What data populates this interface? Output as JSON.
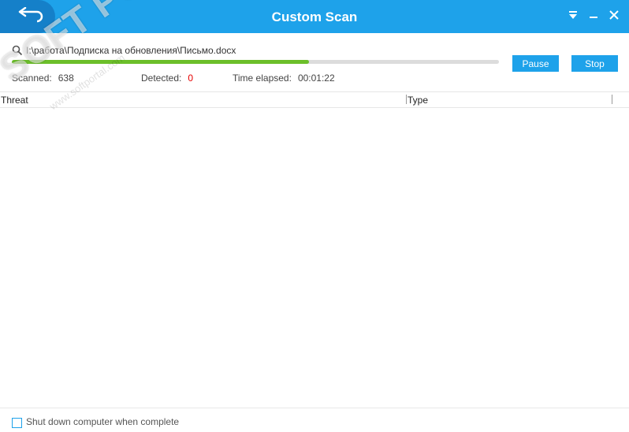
{
  "window": {
    "title": "Custom Scan",
    "back_icon": "back-arrow-icon",
    "controls": [
      "menu-dropdown-icon",
      "minimize-icon",
      "close-icon"
    ]
  },
  "scan": {
    "current_file": "I:\\работа\\Подписка на обновления\\Письмо.docx",
    "progress_percent": 61,
    "scanned_label": "Scanned:",
    "scanned_value": "638",
    "detected_label": "Detected:",
    "detected_value": "0",
    "elapsed_label": "Time elapsed:",
    "elapsed_value": "00:01:22",
    "pause_label": "Pause",
    "stop_label": "Stop"
  },
  "table": {
    "columns": [
      "Threat",
      "Type"
    ],
    "rows": []
  },
  "footer": {
    "shutdown_label": "Shut down computer when complete",
    "shutdown_checked": false
  },
  "watermark": {
    "text": "SOFT PORTAL",
    "sub": "www.softportal.com"
  },
  "colors": {
    "accent": "#1ea2ea",
    "accent_dark": "#1580c9",
    "progress": "#6cbf2a",
    "alert": "#e60000"
  }
}
